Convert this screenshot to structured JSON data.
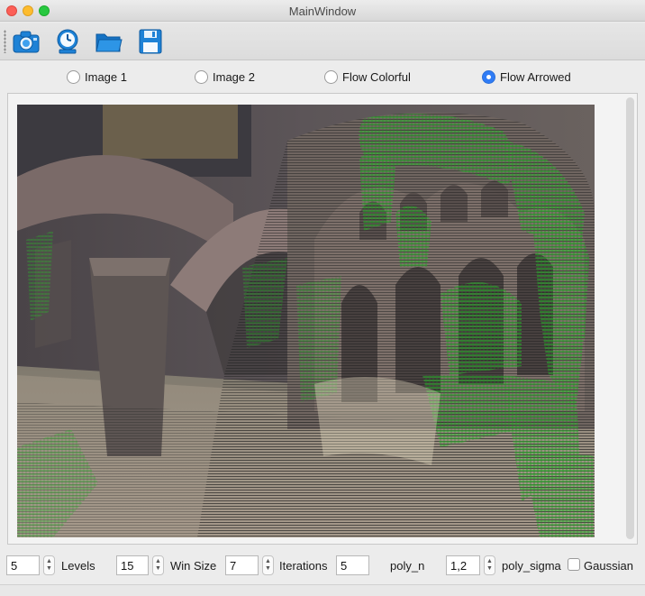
{
  "window": {
    "title": "MainWindow"
  },
  "toolbar": {
    "buttons": [
      {
        "icon": "camera-icon"
      },
      {
        "icon": "clock-icon"
      },
      {
        "icon": "folder-open-icon"
      },
      {
        "icon": "floppy-save-icon"
      }
    ]
  },
  "view_mode": {
    "options": [
      "Image 1",
      "Image 2",
      "Flow Colorful",
      "Flow Arrowed"
    ],
    "selected": "Flow Arrowed"
  },
  "image_view": {
    "flow_color": "#2fb82f"
  },
  "params": {
    "levels": {
      "value": "5",
      "label": "Levels"
    },
    "win_size": {
      "value": "15",
      "label": "Win Size"
    },
    "iterations": {
      "value": "7",
      "label": "Iterations"
    },
    "poly_n": {
      "value": "5",
      "label": "poly_n"
    },
    "poly_sigma": {
      "value": "1,2",
      "label": "poly_sigma"
    },
    "gaussian": {
      "label": "Gaussian",
      "checked": false
    }
  }
}
